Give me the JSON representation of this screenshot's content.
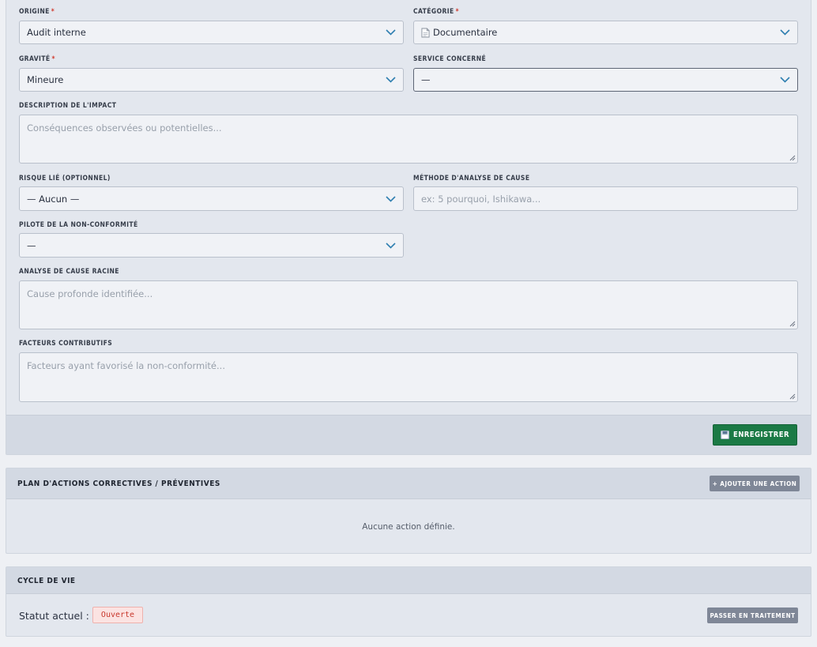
{
  "form": {
    "origine": {
      "label": "ORIGINE",
      "required_mark": "*",
      "value": "Audit interne"
    },
    "categorie": {
      "label": "CATÉGORIE",
      "required_mark": "*",
      "icon": "document-icon",
      "value": "Documentaire"
    },
    "gravite": {
      "label": "GRAVITÉ",
      "required_mark": "*",
      "value": "Mineure"
    },
    "service": {
      "label": "SERVICE CONCERNÉ",
      "value": "—"
    },
    "impact": {
      "label": "DESCRIPTION DE L'IMPACT",
      "placeholder": "Conséquences observées ou potentielles..."
    },
    "risque": {
      "label": "RISQUE LIÉ (OPTIONNEL)",
      "value": "— Aucun —"
    },
    "methode": {
      "label": "MÉTHODE D'ANALYSE DE CAUSE",
      "placeholder": "ex: 5 pourquoi, Ishikawa..."
    },
    "pilote": {
      "label": "PILOTE DE LA NON-CONFORMITÉ",
      "value": "—"
    },
    "cause_racine": {
      "label": "ANALYSE DE CAUSE RACINE",
      "placeholder": "Cause profonde identifiée..."
    },
    "facteurs": {
      "label": "FACTEURS CONTRIBUTIFS",
      "placeholder": "Facteurs ayant favorisé la non-conformité..."
    },
    "save_button": {
      "label": "ENREGISTRER",
      "icon": "floppy-disk-icon",
      "color": "#1b7a45"
    }
  },
  "actions_panel": {
    "title": "PLAN D'ACTIONS CORRECTIVES / PRÉVENTIVES",
    "add_button": "+ AJOUTER UNE ACTION",
    "empty_message": "Aucune action définie."
  },
  "cycle_panel": {
    "title": "CYCLE DE VIE",
    "status_label": "Statut actuel :",
    "status_value": "Ouverte",
    "status_color": "#c8372c",
    "transition_button": "PASSER EN TRAITEMENT"
  }
}
